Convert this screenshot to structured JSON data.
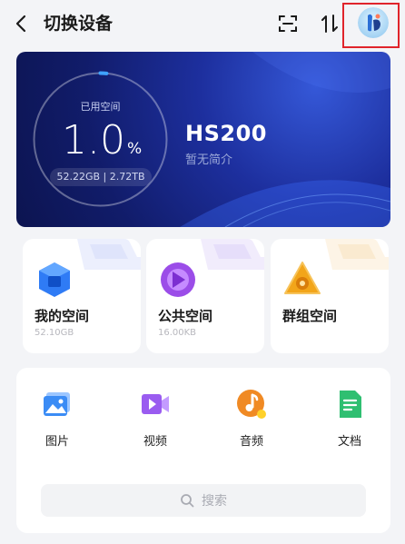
{
  "header": {
    "title": "切换设备",
    "back_icon": "chevron-left-icon",
    "scan_icon": "scan-icon",
    "sort_icon": "sort-icon",
    "avatar_icon": "avatar-icon"
  },
  "storage": {
    "used_label": "已用空间",
    "percent": "1.0",
    "percent_unit": "%",
    "used_fraction": 0.01,
    "capacity": "52.22GB | 2.72TB"
  },
  "device": {
    "name": "HS200",
    "description": "暂无简介"
  },
  "spaces": [
    {
      "name": "我的空间",
      "size": "52.10GB",
      "icon": "my-space-icon",
      "color": "#2f7bf5"
    },
    {
      "name": "公共空间",
      "size": "16.00KB",
      "icon": "public-space-icon",
      "color": "#9b4de8"
    },
    {
      "name": "群组空间",
      "size": "",
      "icon": "group-space-icon",
      "color": "#f2a51a"
    }
  ],
  "files": [
    {
      "label": "图片",
      "icon": "image-icon",
      "color": "#3b8cf5"
    },
    {
      "label": "视频",
      "icon": "video-icon",
      "color": "#9a5cf0"
    },
    {
      "label": "音频",
      "icon": "music-icon",
      "color": "#f08a24"
    },
    {
      "label": "文档",
      "icon": "document-icon",
      "color": "#2fbf71"
    }
  ],
  "search": {
    "placeholder": "搜索",
    "icon": "search-icon"
  },
  "colors": {
    "highlight": "#e0242b",
    "banner": "#1d2f9e",
    "background": "#f3f4f7"
  }
}
